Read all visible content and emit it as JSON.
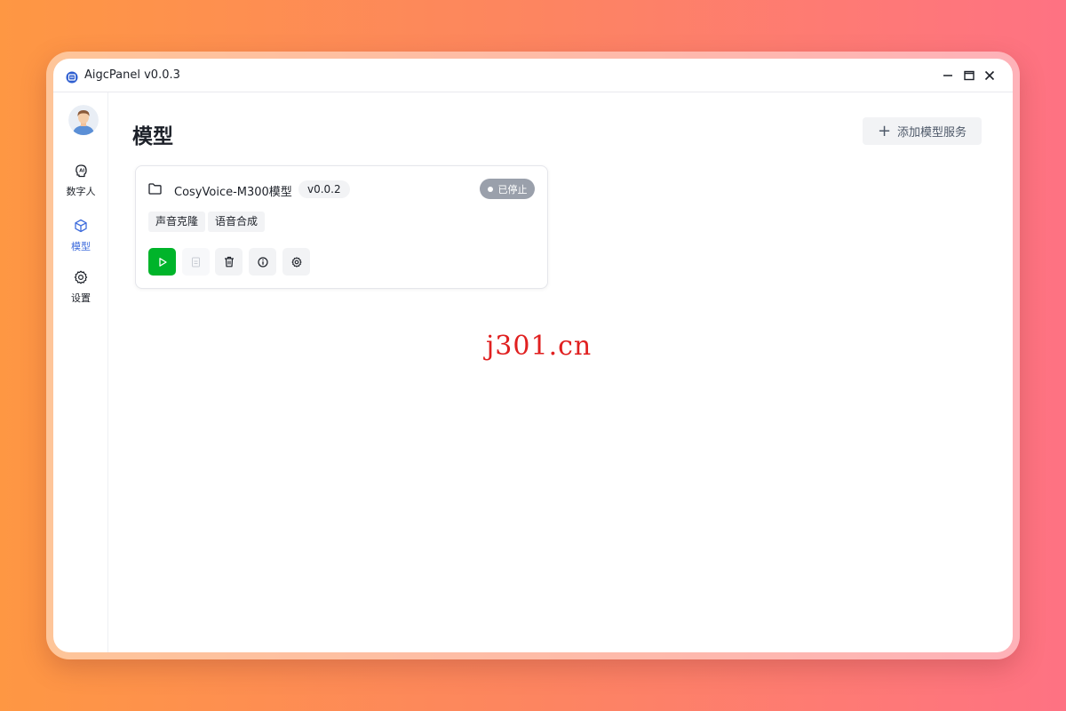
{
  "window": {
    "title": "AigcPanel v0.0.3"
  },
  "sidebar": {
    "items": [
      {
        "label": "数字人",
        "icon": "ai-head-icon",
        "active": false
      },
      {
        "label": "模型",
        "icon": "cube-icon",
        "active": true
      },
      {
        "label": "设置",
        "icon": "gear-icon",
        "active": false
      }
    ]
  },
  "main": {
    "title": "模型",
    "add_button": "添加模型服务",
    "cards": [
      {
        "name": "CosyVoice-M300模型",
        "version": "v0.0.2",
        "status": "已停止",
        "tags": [
          "声音克隆",
          "语音合成"
        ]
      }
    ]
  },
  "watermark": "j301.cn",
  "colors": {
    "accent": "#3d6bdc",
    "play": "#00b42a",
    "status_stopped": "#9aa0ab",
    "watermark": "#e02020"
  }
}
